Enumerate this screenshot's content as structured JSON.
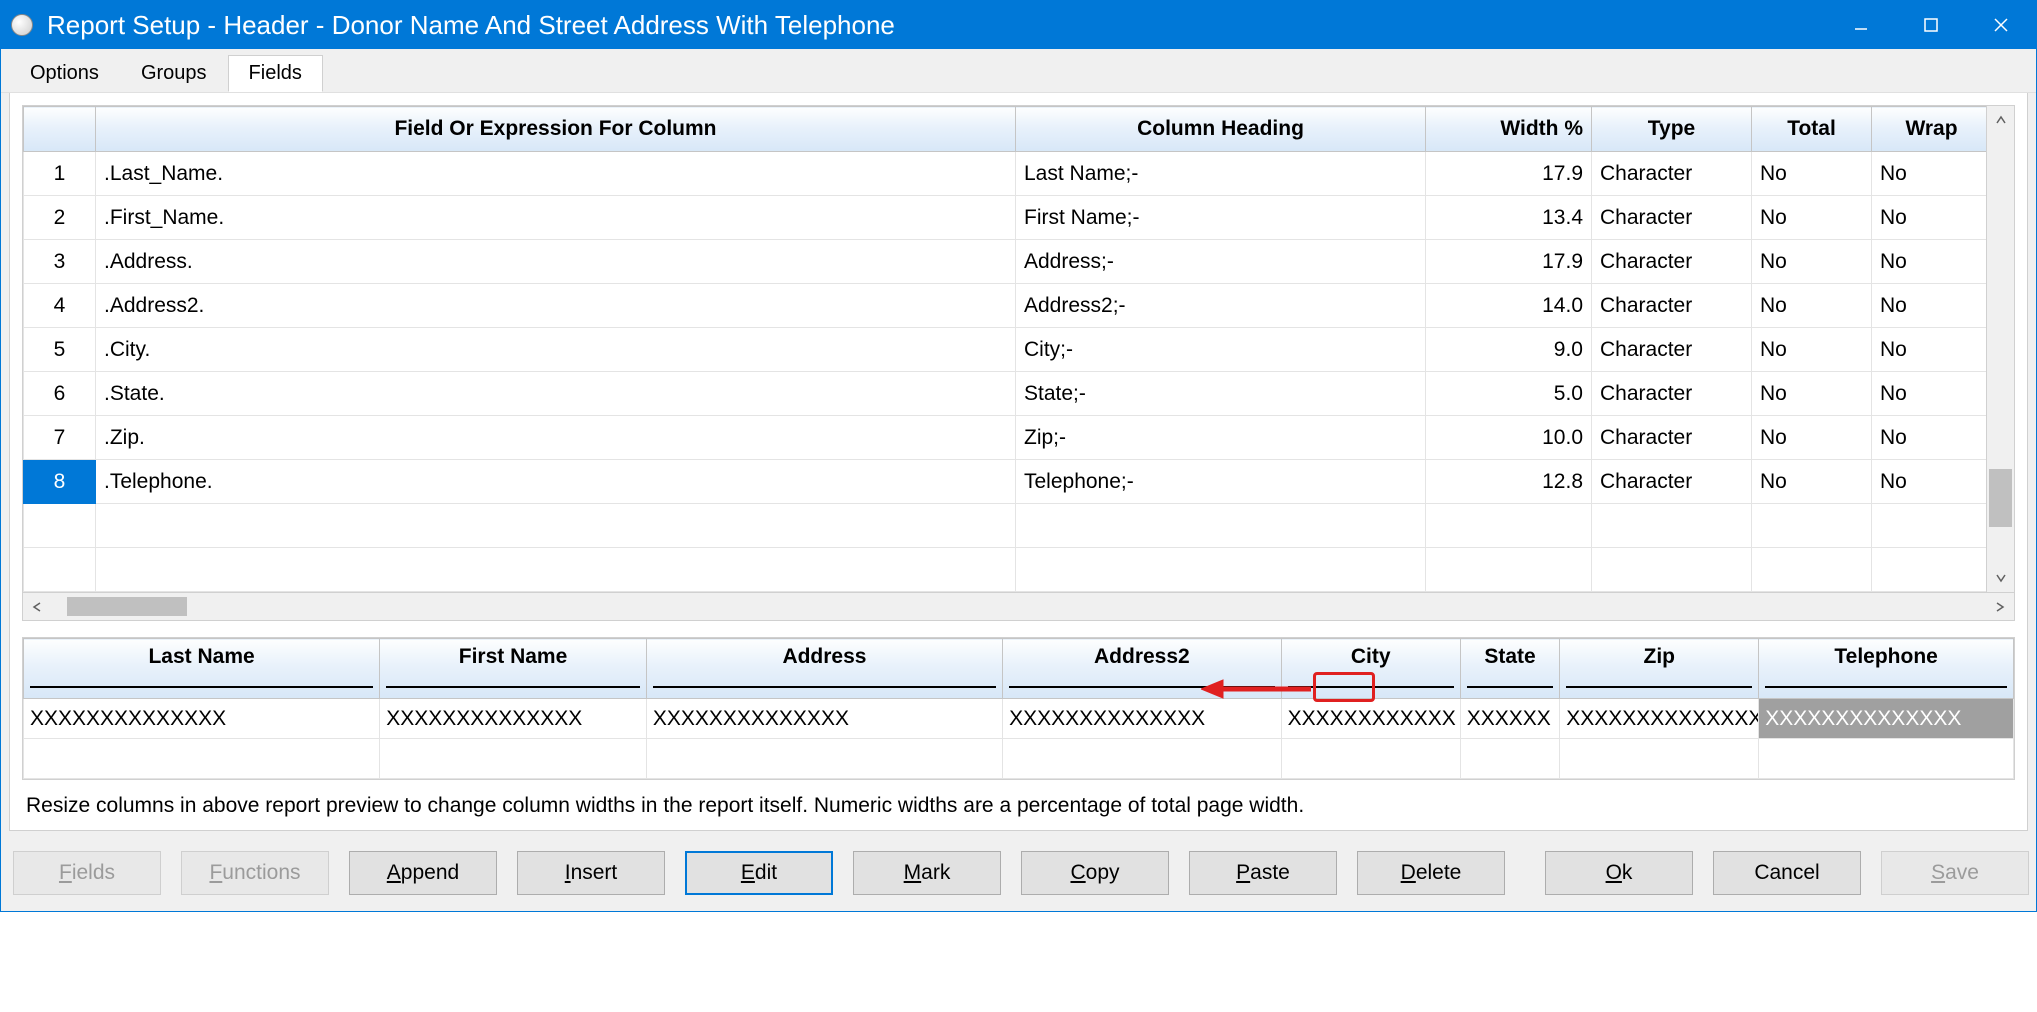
{
  "window": {
    "title": "Report Setup - Header - Donor Name And Street Address With Telephone"
  },
  "tabs": [
    {
      "label": "Options",
      "active": false
    },
    {
      "label": "Groups",
      "active": false
    },
    {
      "label": "Fields",
      "active": true
    }
  ],
  "grid": {
    "headers": {
      "rownum": "",
      "field": "Field Or Expression For Column",
      "heading": "Column Heading",
      "width": "Width %",
      "type": "Type",
      "total": "Total",
      "wrap": "Wrap"
    },
    "rows": [
      {
        "num": "1",
        "field": ".Last_Name.",
        "heading": "Last Name;-",
        "width": "17.9",
        "type": "Character",
        "total": "No",
        "wrap": "No",
        "selected": false
      },
      {
        "num": "2",
        "field": ".First_Name.",
        "heading": "First Name;-",
        "width": "13.4",
        "type": "Character",
        "total": "No",
        "wrap": "No",
        "selected": false
      },
      {
        "num": "3",
        "field": ".Address.",
        "heading": "Address;-",
        "width": "17.9",
        "type": "Character",
        "total": "No",
        "wrap": "No",
        "selected": false
      },
      {
        "num": "4",
        "field": ".Address2.",
        "heading": "Address2;-",
        "width": "14.0",
        "type": "Character",
        "total": "No",
        "wrap": "No",
        "selected": false
      },
      {
        "num": "5",
        "field": ".City.",
        "heading": "City;-",
        "width": "9.0",
        "type": "Character",
        "total": "No",
        "wrap": "No",
        "selected": false
      },
      {
        "num": "6",
        "field": ".State.",
        "heading": "State;-",
        "width": "5.0",
        "type": "Character",
        "total": "No",
        "wrap": "No",
        "selected": false
      },
      {
        "num": "7",
        "field": ".Zip.",
        "heading": "Zip;-",
        "width": "10.0",
        "type": "Character",
        "total": "No",
        "wrap": "No",
        "selected": false
      },
      {
        "num": "8",
        "field": ".Telephone.",
        "heading": "Telephone;-",
        "width": "12.8",
        "type": "Character",
        "total": "No",
        "wrap": "No",
        "selected": true
      }
    ],
    "emptyRows": 2
  },
  "preview": {
    "headers": [
      "Last Name",
      "First Name",
      "Address",
      "Address2",
      "City",
      "State",
      "Zip",
      "Telephone"
    ],
    "row": [
      "XXXXXXXXXXXXXX",
      "XXXXXXXXXXXXXX",
      "XXXXXXXXXXXXXX",
      "XXXXXXXXXXXXXX",
      "XXXXXXXXXXXX",
      "XXXXXX",
      "XXXXXXXXXXXXXX",
      "XXXXXXXXXXXXXX"
    ],
    "highlightCol": 7
  },
  "hint": "Resize columns in above report preview to change column widths in the report itself. Numeric widths are a percentage of total page width.",
  "buttons": {
    "fields": "Fields",
    "functions": "Functions",
    "append": "Append",
    "insert": "Insert",
    "edit": "Edit",
    "mark": "Mark",
    "copy": "Copy",
    "paste": "Paste",
    "delete": "Delete",
    "ok": "Ok",
    "cancel": "Cancel",
    "save": "Save"
  }
}
